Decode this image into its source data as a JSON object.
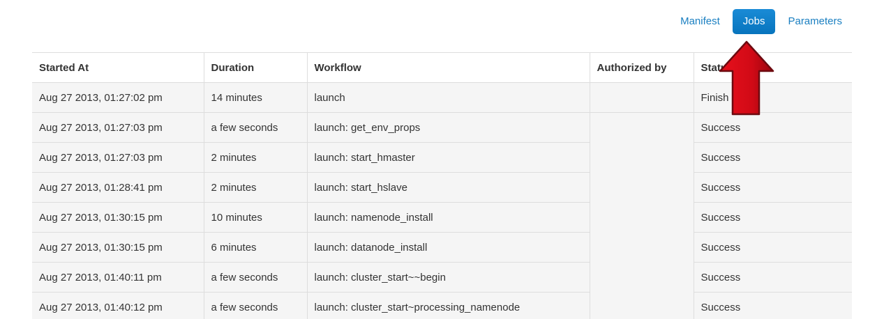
{
  "nav": {
    "items": [
      {
        "label": "Manifest",
        "active": false
      },
      {
        "label": "Jobs",
        "active": true
      },
      {
        "label": "Parameters",
        "active": false
      }
    ]
  },
  "table": {
    "headers": [
      "Started At",
      "Duration",
      "Workflow",
      "Authorized by",
      "Status"
    ],
    "rows": [
      {
        "started": "Aug 27 2013, 01:27:02 pm",
        "duration": "14 minutes",
        "workflow": "launch",
        "authorized": "",
        "status": "Finish"
      },
      {
        "started": "Aug 27 2013, 01:27:03 pm",
        "duration": "a few seconds",
        "workflow": "launch: get_env_props",
        "authorized": "",
        "status": "Success"
      },
      {
        "started": "Aug 27 2013, 01:27:03 pm",
        "duration": "2 minutes",
        "workflow": "launch: start_hmaster",
        "authorized": "",
        "status": "Success"
      },
      {
        "started": "Aug 27 2013, 01:28:41 pm",
        "duration": "2 minutes",
        "workflow": "launch: start_hslave",
        "authorized": "",
        "status": "Success"
      },
      {
        "started": "Aug 27 2013, 01:30:15 pm",
        "duration": "10 minutes",
        "workflow": "launch: namenode_install",
        "authorized": "",
        "status": "Success"
      },
      {
        "started": "Aug 27 2013, 01:30:15 pm",
        "duration": "6 minutes",
        "workflow": "launch: datanode_install",
        "authorized": "",
        "status": "Success"
      },
      {
        "started": "Aug 27 2013, 01:40:11 pm",
        "duration": "a few seconds",
        "workflow": "launch: cluster_start~~begin",
        "authorized": "",
        "status": "Success"
      },
      {
        "started": "Aug 27 2013, 01:40:12 pm",
        "duration": "a few seconds",
        "workflow": "launch: cluster_start~processing_namenode",
        "authorized": "",
        "status": "Success"
      }
    ]
  },
  "annotation": {
    "arrow_color": "#cc0a14",
    "arrow_icon": "red-up-arrow-icon"
  }
}
